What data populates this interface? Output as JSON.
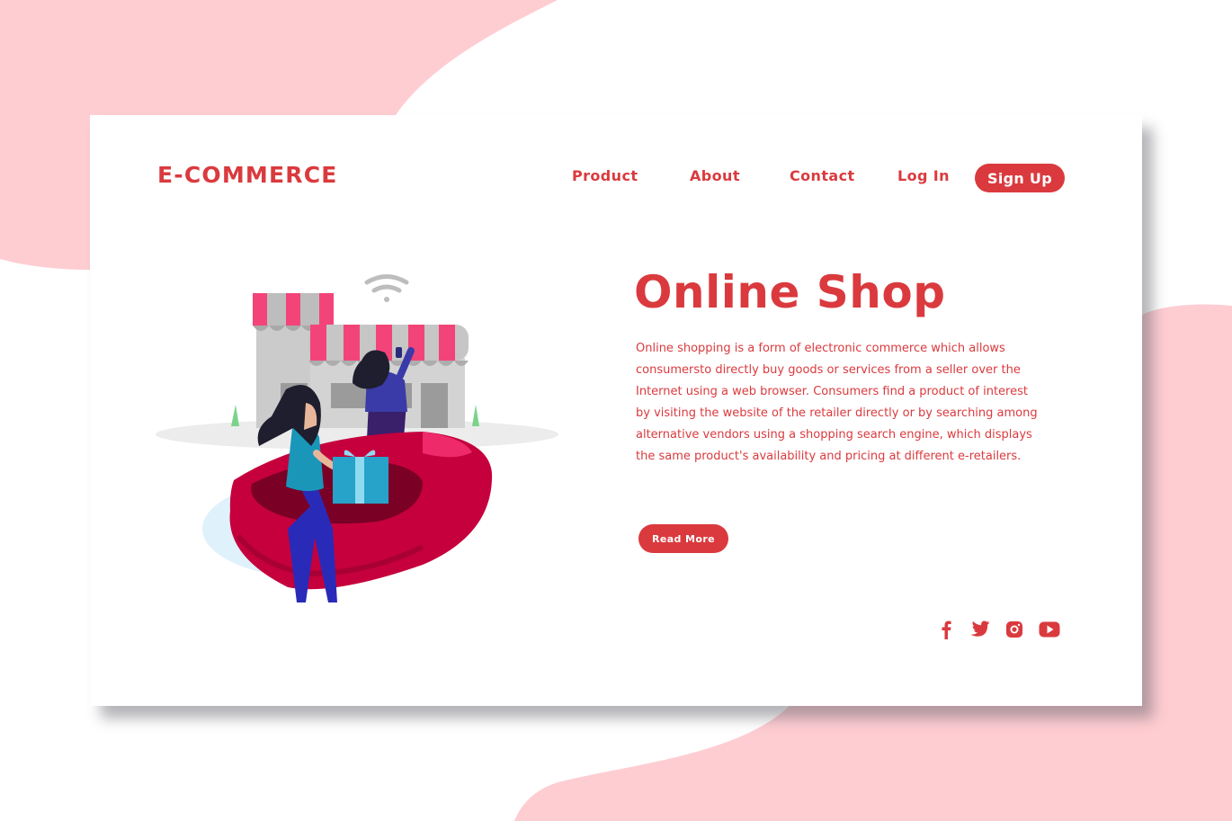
{
  "brand": {
    "logo": "E-COMMERCE"
  },
  "nav": {
    "product": "Product",
    "about": "About",
    "contact": "Contact",
    "login": "Log In",
    "signup": "Sign Up"
  },
  "hero": {
    "title": "Online Shop",
    "body": "Online shopping is a form of electronic commerce which allows consumersto directly buy goods or services from a seller over the Internet using a web browser. Consumers find a product of interest by visiting the website of the retailer directly or by searching among alternative vendors using a shopping search engine, which displays the same product's availability and pricing at different e-retailers.",
    "cta": "Read More"
  },
  "social": {
    "icons": [
      "facebook-icon",
      "twitter-icon",
      "instagram-icon",
      "youtube-icon"
    ]
  },
  "colors": {
    "accent": "#da3a3e",
    "blob": "#fecdd2",
    "awning": "#f3447a",
    "store": "#c9c9c9"
  }
}
